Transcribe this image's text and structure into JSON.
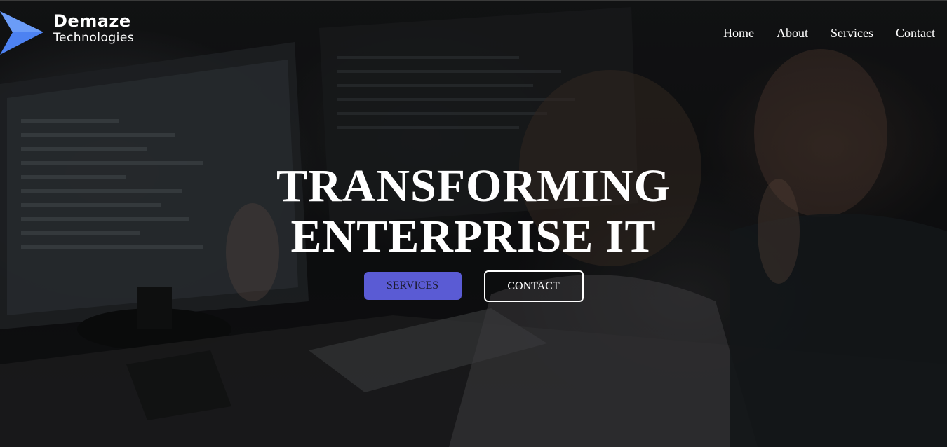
{
  "brand": {
    "name": "Demaze",
    "subtitle": "Technologies",
    "logo_icon": "chevron-arrow-logo",
    "accent_color": "#4d82f2"
  },
  "nav": {
    "items": [
      {
        "label": "Home"
      },
      {
        "label": "About"
      },
      {
        "label": "Services"
      },
      {
        "label": "Contact"
      }
    ]
  },
  "hero": {
    "title_line1": "TRANSFORMING",
    "title_line2": "ENTERPRISE IT",
    "primary_button": "SERVICES",
    "secondary_button": "CONTACT",
    "primary_color": "#5a5bd4"
  }
}
